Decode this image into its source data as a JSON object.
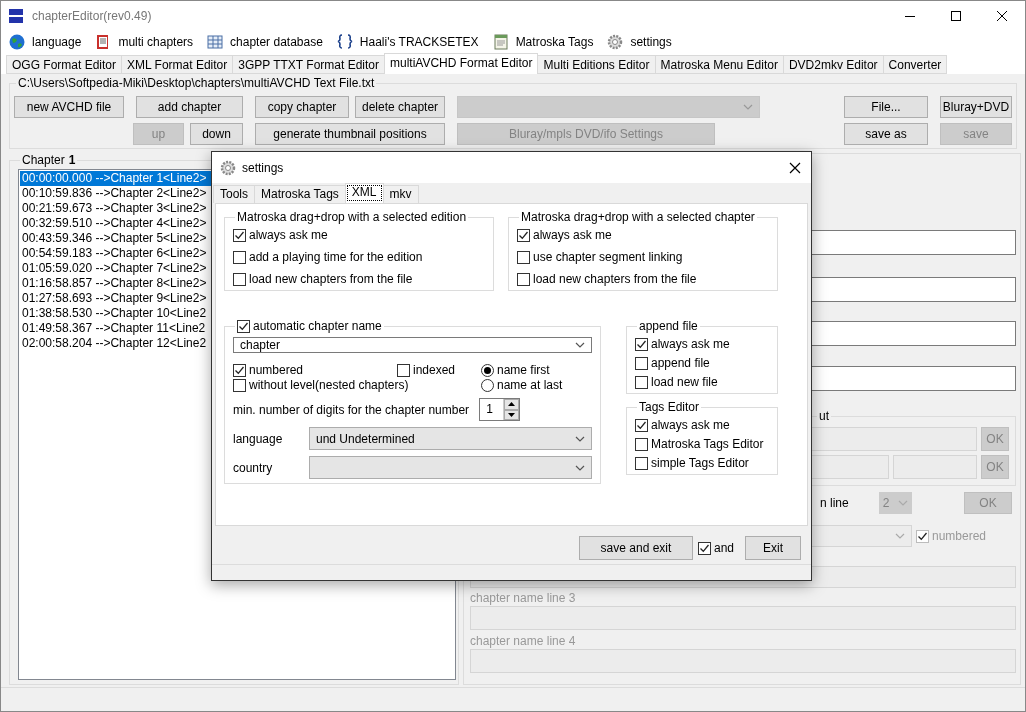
{
  "window": {
    "title": "chapterEditor(rev0.49)"
  },
  "menu": [
    {
      "label": "language"
    },
    {
      "label": "multi chapters"
    },
    {
      "label": "chapter database"
    },
    {
      "label": "Haali's TRACKSETEX"
    },
    {
      "label": "Matroska Tags"
    },
    {
      "label": "settings"
    }
  ],
  "tabs": [
    {
      "label": "OGG Format Editor",
      "selected": false
    },
    {
      "label": "XML Format Editor",
      "selected": false
    },
    {
      "label": "3GPP TTXT Format Editor",
      "selected": false
    },
    {
      "label": "multiAVCHD Format Editor",
      "selected": true
    },
    {
      "label": "Multi Editions Editor",
      "selected": false
    },
    {
      "label": "Matroska Menu Editor",
      "selected": false
    },
    {
      "label": "DVD2mkv Editor",
      "selected": false
    },
    {
      "label": "Converter",
      "selected": false
    }
  ],
  "file_path": "C:\\Users\\Softpedia-Miki\\Desktop\\chapters\\multiAVCHD Text File.txt",
  "toolbar": [
    {
      "kind": "button",
      "label": "new AVCHD file",
      "disabled": false
    },
    {
      "kind": "button",
      "label": "add chapter",
      "disabled": false
    },
    {
      "kind": "button",
      "label": "copy chapter",
      "disabled": false
    },
    {
      "kind": "button",
      "label": "delete chapter",
      "disabled": false
    },
    {
      "kind": "dropdown",
      "disabled": true
    },
    {
      "kind": "button",
      "label": "File...",
      "disabled": false
    },
    {
      "kind": "button",
      "label": "Bluray+DVD",
      "disabled": false
    },
    {
      "kind": "button",
      "label": "up",
      "disabled": true
    },
    {
      "kind": "button",
      "label": "down",
      "disabled": false
    },
    {
      "kind": "button",
      "label": "generate thumbnail positions",
      "disabled": false
    },
    {
      "kind": "button",
      "label": "Bluray/mpls DVD/ifo Settings",
      "disabled": true
    },
    {
      "kind": "button",
      "label": "save as",
      "disabled": false
    },
    {
      "kind": "button",
      "label": "save",
      "disabled": true
    }
  ],
  "chapter_panel": {
    "title": "Chapter",
    "number": "1",
    "items": [
      {
        "text": "00:00:00.000 -->Chapter 1<Line2>",
        "selected": true
      },
      {
        "text": "00:10:59.836 -->Chapter 2<Line2>",
        "selected": false
      },
      {
        "text": "00:21:59.673 -->Chapter 3<Line2>",
        "selected": false
      },
      {
        "text": "00:32:59.510 -->Chapter 4<Line2>",
        "selected": false
      },
      {
        "text": "00:43:59.346 -->Chapter 5<Line2>",
        "selected": false
      },
      {
        "text": "00:54:59.183 -->Chapter 6<Line2>",
        "selected": false
      },
      {
        "text": "01:05:59.020 -->Chapter 7<Line2>",
        "selected": false
      },
      {
        "text": "01:16:58.857 -->Chapter 8<Line2>",
        "selected": false
      },
      {
        "text": "01:27:58.693 -->Chapter 9<Line2>",
        "selected": false
      },
      {
        "text": "01:38:58.530 -->Chapter 10<Line2",
        "selected": false
      },
      {
        "text": "01:49:58.367 -->Chapter 11<Line2",
        "selected": false
      },
      {
        "text": "02:00:58.204 -->Chapter 12<Line2",
        "selected": false
      }
    ]
  },
  "details": {
    "group_title_partial": "ut",
    "ok_buttons": [
      "OK",
      "OK"
    ],
    "line_label_partial": "n line",
    "line_count": "2",
    "line_ok": "OK",
    "numbered": {
      "label": "numbered",
      "checked": true
    },
    "name_lines": [
      "chapter name line 3",
      "chapter name line 4"
    ]
  },
  "settings_dialog": {
    "title": "settings",
    "tabs": [
      {
        "label": "Tools",
        "selected": false
      },
      {
        "label": "Matroska Tags",
        "selected": false
      },
      {
        "label": "XML",
        "selected": true
      },
      {
        "label": "mkv",
        "selected": false
      }
    ],
    "edition_group": {
      "title": "Matroska drag+drop with a selected edition",
      "options": [
        {
          "label": "always ask me",
          "checked": true
        },
        {
          "label": "add a playing time for the edition",
          "checked": false
        },
        {
          "label": "load new chapters from the file",
          "checked": false
        }
      ]
    },
    "chapter_group": {
      "title": "Matroska drag+drop with a selected chapter",
      "options": [
        {
          "label": "always ask me",
          "checked": true
        },
        {
          "label": "use chapter segment linking",
          "checked": false
        },
        {
          "label": "load new chapters from the file",
          "checked": false
        }
      ]
    },
    "auto_name": {
      "label": "automatic chapter name",
      "checked": true,
      "name": "chapter",
      "options": [
        {
          "kind": "checkbox",
          "label": "numbered",
          "checked": true
        },
        {
          "kind": "checkbox",
          "label": "indexed",
          "checked": false
        },
        {
          "kind": "radio",
          "label": "name first",
          "selected": true
        },
        {
          "kind": "checkbox",
          "label": "without level(nested chapters)",
          "checked": false
        },
        {
          "kind": "spacer"
        },
        {
          "kind": "radio",
          "label": "name at last",
          "selected": false
        }
      ],
      "digits_label": "min. number of digits for the chapter number",
      "digits": "1",
      "language_label": "language",
      "language": "und Undetermined",
      "country_label": "country"
    },
    "append_group": {
      "title": "append file",
      "options": [
        {
          "label": "always ask me",
          "checked": true
        },
        {
          "label": "append file",
          "checked": false
        },
        {
          "label": "load new file",
          "checked": false
        }
      ]
    },
    "tags_group": {
      "title": "Tags Editor",
      "options": [
        {
          "label": "always ask me",
          "checked": true
        },
        {
          "label": "Matroska Tags Editor",
          "checked": false
        },
        {
          "label": "simple Tags Editor",
          "checked": false
        }
      ]
    },
    "save_button": "save and exit",
    "and_option": {
      "label": "and",
      "checked": true
    },
    "exit_button": "Exit"
  }
}
